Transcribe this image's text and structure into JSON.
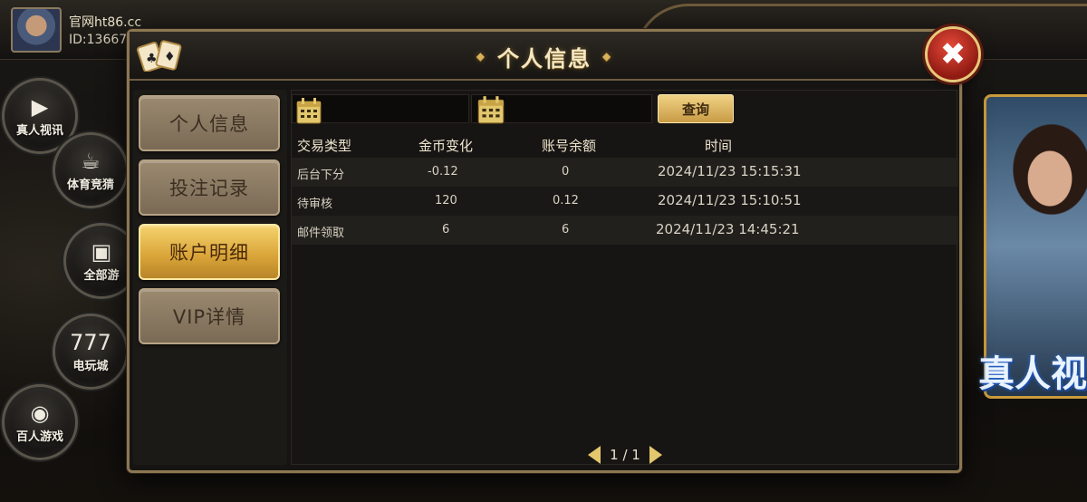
{
  "player": {
    "name": "官网ht86.cc",
    "id": "ID:13667"
  },
  "side_menu": [
    {
      "label": "真人视讯",
      "icon": "video-camera-icon"
    },
    {
      "label": "体育竞猜",
      "icon": "trophy-icon"
    },
    {
      "label": "全部游",
      "icon": "grid-icon"
    },
    {
      "label": "电玩城",
      "icon": "slot-777-icon"
    },
    {
      "label": "百人游戏",
      "icon": "chip-icon"
    }
  ],
  "promo": {
    "title": "真人视"
  },
  "modal": {
    "title": "个人信息",
    "nav": [
      {
        "label": "个人信息",
        "active": false
      },
      {
        "label": "投注记录",
        "active": false
      },
      {
        "label": "账户明细",
        "active": true
      },
      {
        "label": "VIP详情",
        "active": false
      }
    ],
    "query_label": "查询",
    "table": {
      "headers": [
        "交易类型",
        "金币变化",
        "账号余额",
        "时间"
      ],
      "rows": [
        {
          "type": "后台下分",
          "change": "-0.12",
          "balance": "0",
          "time": "2024/11/23 15:15:31"
        },
        {
          "type": "待审核",
          "change": "120",
          "balance": "0.12",
          "time": "2024/11/23 15:10:51"
        },
        {
          "type": "邮件领取",
          "change": "6",
          "balance": "6",
          "time": "2024/11/23 14:45:21"
        }
      ]
    },
    "pager": "1 / 1"
  },
  "colors": {
    "accent_gold": "#d8a337",
    "close_red": "#c23020",
    "panel_bg": "#171513"
  }
}
